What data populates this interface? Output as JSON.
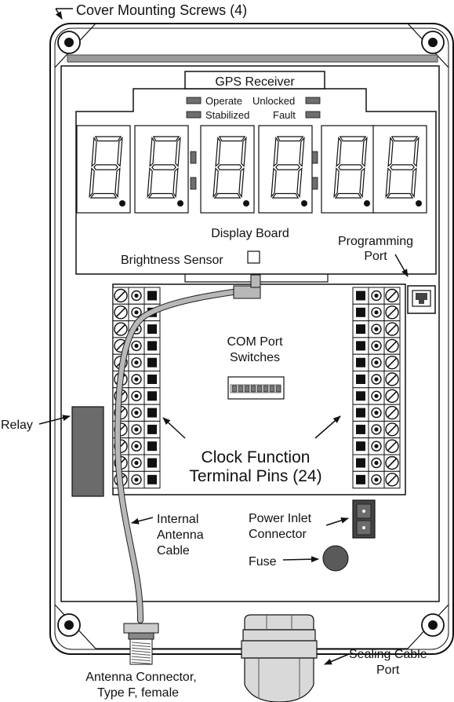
{
  "labels": {
    "cover_screws": "Cover Mounting Screws (4)",
    "gps_receiver": "GPS Receiver",
    "operate": "Operate",
    "unlocked": "Unlocked",
    "stabilized": "Stabilized",
    "fault": "Fault",
    "display_board": "Display Board",
    "brightness_sensor": "Brightness Sensor",
    "programming_port_1": "Programming",
    "programming_port_2": "Port",
    "com_port_1": "COM Port",
    "com_port_2": "Switches",
    "relay": "Relay",
    "clock_function_1": "Clock Function",
    "clock_function_2": "Terminal Pins (24)",
    "internal_antenna_1": "Internal",
    "internal_antenna_2": "Antenna",
    "internal_antenna_3": "Cable",
    "power_inlet_1": "Power Inlet",
    "power_inlet_2": "Connector",
    "fuse": "Fuse",
    "sealing_cable_1": "Sealing Cable",
    "sealing_cable_2": "Port",
    "antenna_connector_1": "Antenna Connector,",
    "antenna_connector_2": "Type F, female"
  },
  "colors": {
    "outline": "#111111",
    "gasket": "#9a9a9a",
    "led": "#6e6e6e",
    "relay": "#6b6b6b",
    "fuse": "#5a5a5a",
    "cable": "#b8b8b8",
    "gland": "#d9d9d9"
  }
}
